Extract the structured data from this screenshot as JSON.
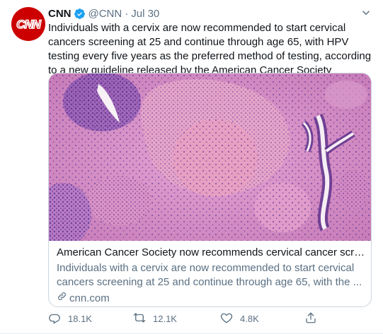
{
  "tweet": {
    "name": "CNN",
    "handle": "@CNN",
    "separator": "·",
    "time": "Jul 30",
    "avatar_text": "CNN",
    "text": "Individuals with a cervix are now recommended to start cervical cancers screening at 25 and continue through age 65, with HPV testing every five years as the preferred method of testing, according to a new guideline released by the American Cancer Society",
    "card": {
      "title": "American Cancer Society now recommends cervical cancer screeni...",
      "description": "Individuals with a cervix are now recommended to start cervical cancers screening at 25 and continue through age 65, with the ...",
      "domain": "cnn.com"
    },
    "actions": {
      "reply_count": "18.1K",
      "retweet_count": "12.1K",
      "like_count": "4.8K"
    }
  },
  "colors": {
    "brand_red": "#cc0000",
    "verified_blue": "#1da1f2",
    "muted": "#5b7083"
  },
  "icons": {
    "reply": "reply-icon",
    "retweet": "retweet-icon",
    "like": "heart-icon",
    "share": "share-icon",
    "link": "link-icon",
    "more": "chevron-down-icon",
    "verified": "verified-badge-icon"
  }
}
